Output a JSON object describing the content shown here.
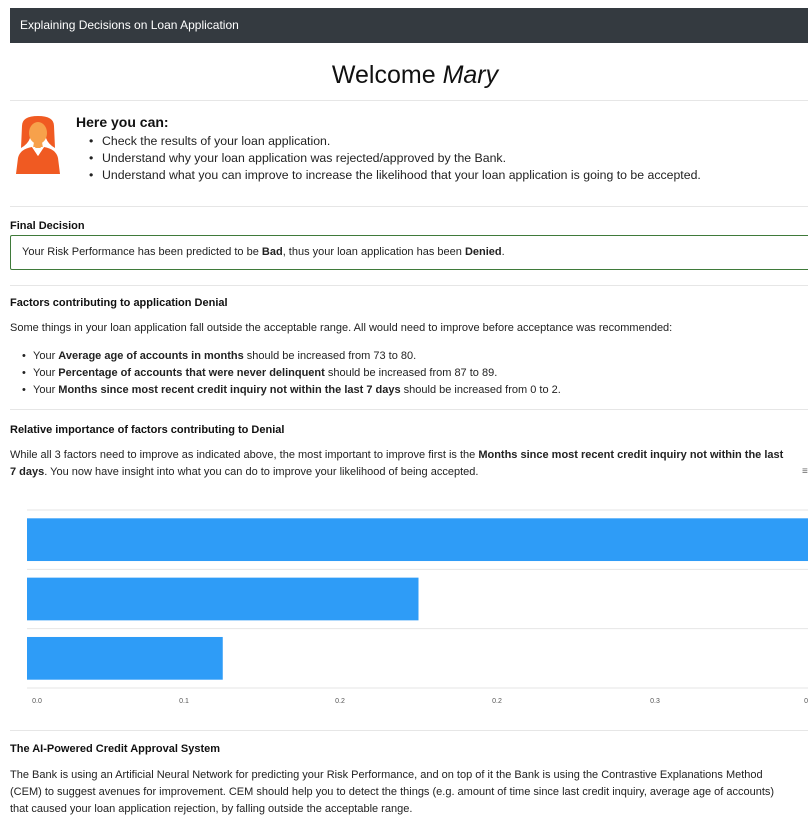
{
  "navbar": {
    "title": "Explaining Decisions on Loan Application"
  },
  "welcome": {
    "prefix": "Welcome ",
    "name": "Mary"
  },
  "intro": {
    "title": "Here you can:",
    "items": [
      "Check the results of your loan application.",
      "Understand why your loan application was rejected/approved by the Bank.",
      "Understand what you can improve to increase the likelihood that your loan application is going to be accepted."
    ]
  },
  "final_decision": {
    "heading": "Final Decision",
    "text_1": "Your Risk Performance has been predicted to be ",
    "risk": "Bad",
    "text_2": ", thus your loan application has been ",
    "decision": "Denied",
    "text_3": "."
  },
  "factors": {
    "heading": "Factors contributing to application Denial",
    "intro": "Some things in your loan application fall outside the acceptable range. All would need to improve before acceptance was recommended:",
    "items": [
      {
        "pre": "Your ",
        "feature": "Average age of accounts in months",
        "post": " should be increased from 73 to 80."
      },
      {
        "pre": "Your ",
        "feature": "Percentage of accounts that were never delinquent",
        "post": " should be increased from 87 to 89."
      },
      {
        "pre": "Your ",
        "feature": "Months since most recent credit inquiry not within the last 7 days",
        "post": " should be increased from 0 to 2."
      }
    ]
  },
  "importance": {
    "heading": "Relative importance of factors contributing to Denial",
    "line1_pre": "While all 3 factors need to improve as indicated above, the most important to improve first is the ",
    "line1_bold": "Months since most recent credit inquiry not within the last",
    "line2_bold": "7 days",
    "line2_post": ". You now have insight into what you can do to improve your likelihood of being accepted."
  },
  "chart_menu_icon": "hamburger-menu-icon",
  "chart_data": {
    "type": "bar",
    "orientation": "horizontal",
    "values": [
      0.5,
      0.25,
      0.125
    ],
    "xlim": [
      0,
      0.5
    ],
    "tick_values": [
      0,
      0.1,
      0.2,
      0.3,
      0.4
    ],
    "tick_labels": [
      "0.0",
      "0.1",
      "0.2",
      "0.2",
      "0.3",
      "0"
    ],
    "bar_color": "#2e9cf7",
    "grid": true
  },
  "ai_system": {
    "heading": "The AI-Powered Credit Approval System",
    "lines": [
      "The Bank is using an Artificial Neural Network for predicting your Risk Performance, and on top of it the Bank is using the Contrastive Explanations Method",
      "(CEM) to suggest avenues for improvement. CEM should help you to detect the things (e.g. amount of time since last credit inquiry, average age of accounts)",
      "that caused your loan application rejection, by falling outside the acceptable range."
    ]
  }
}
